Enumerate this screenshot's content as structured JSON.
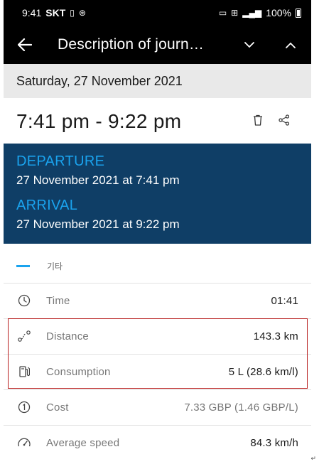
{
  "status_bar": {
    "time": "9:41",
    "carrier": "SKT",
    "battery_percent": "100%"
  },
  "app_bar": {
    "title": "Description of journ…"
  },
  "journey": {
    "date": "Saturday, 27 November 2021",
    "time_range": "7:41 pm - 9:22 pm",
    "departure_label": "DEPARTURE",
    "departure_value": "27 November 2021 at 7:41 pm",
    "arrival_label": "ARRIVAL",
    "arrival_value": "27 November 2021 at 9:22 pm",
    "category": "기타"
  },
  "stats": [
    {
      "icon": "clock-icon",
      "label": "Time",
      "value": "01:41"
    },
    {
      "icon": "route-icon",
      "label": "Distance",
      "value": "143.3 km"
    },
    {
      "icon": "fuel-pump-icon",
      "label": "Consumption",
      "value": "5 L (28.6 km/l)"
    },
    {
      "icon": "coin-icon",
      "label": "Cost",
      "value": "7.33 GBP (1.46 GBP/L)"
    },
    {
      "icon": "speedometer-icon",
      "label": "Average speed",
      "value": "84.3 km/h"
    }
  ],
  "colors": {
    "accent": "#1aa3ee",
    "panel": "#0f3e66",
    "highlight": "#b81f1f"
  },
  "corner_mark": "↵"
}
